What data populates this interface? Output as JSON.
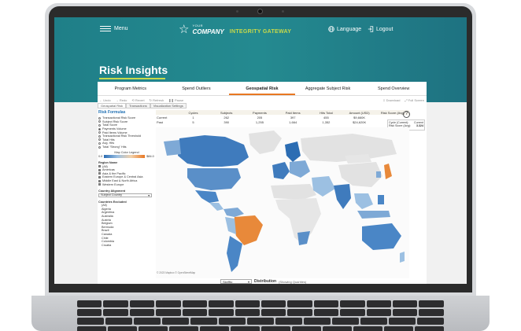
{
  "app": {
    "menu_label": "Menu",
    "logo_small": "YOUR",
    "logo_company": "COMPANY",
    "logo_gateway": "INTEGRITY GATEWAY",
    "language_label": "Language",
    "logout_label": "Logout",
    "page_title": "Risk Insights"
  },
  "tabs": [
    {
      "label": "Program Metrics"
    },
    {
      "label": "Spend Outliers"
    },
    {
      "label": "Geospatial Risk",
      "active": true
    },
    {
      "label": "Aggregate Subject Risk"
    },
    {
      "label": "Spend Overview"
    }
  ],
  "toolbar": {
    "undo": "Undo",
    "redo": "Redo",
    "revert": "Revert",
    "refresh": "Refresh",
    "pause": "Pause",
    "download": "Download",
    "full_screen": "Full Screen"
  },
  "subtabs": [
    "Geospatial Risk",
    "Transactions",
    "Visualization Settings"
  ],
  "left_panel": {
    "risk_formulas_title": "Risk Formulas",
    "options": [
      {
        "label": "Transactional Risk Score",
        "on": false
      },
      {
        "label": "Subject Risk Score",
        "on": false
      },
      {
        "label": "Total Score",
        "on": false
      },
      {
        "label": "Payments Volume",
        "on": true
      },
      {
        "label": "Paid Items Volume",
        "on": false
      },
      {
        "label": "Transactional Risk Threshold",
        "on": false
      },
      {
        "label": "Total Hits",
        "on": false
      },
      {
        "label": "Avg. Hits",
        "on": false
      },
      {
        "label": "Total \"Strong\" Hits",
        "on": false
      }
    ],
    "legend_title": "Map Color Legend",
    "legend_min": "0.0",
    "legend_max": "$84.0",
    "region_title": "Region Name",
    "regions": [
      {
        "label": "(All)",
        "on": true
      },
      {
        "label": "Americas",
        "on": true
      },
      {
        "label": "Asia & the Pacific",
        "on": true
      },
      {
        "label": "Eastern Europe & Central Asia",
        "on": true
      },
      {
        "label": "Middle East & North Africa",
        "on": true
      },
      {
        "label": "Western Europe",
        "on": true
      }
    ],
    "country_alignment_title": "Country Alignment",
    "country_alignment_value": "Subject Country",
    "countries_excluded_title": "Countries Excluded",
    "countries": [
      "(All)",
      "Algeria",
      "Argentina",
      "Australia",
      "Austria",
      "Belgium",
      "Bermuda",
      "Brazil",
      "Canada",
      "Chile",
      "Colombia",
      "Croatia"
    ]
  },
  "summary_table": {
    "headers": [
      "",
      "Cycles",
      "Subjects",
      "Payments",
      "Paid Items",
      "Hits Total",
      "Amount (USD)",
      "Risk Score (Avg)"
    ],
    "rows": [
      [
        "Current",
        "1",
        "262",
        "205",
        "397",
        "455",
        "$9,660K",
        ""
      ],
      [
        "Past",
        "5",
        "390",
        "1,255",
        "1,664",
        "1,352",
        "$24,620K",
        ""
      ]
    ]
  },
  "tooltip": {
    "label1": "Cycle (Current):",
    "value1": "Current",
    "label2": "Risk Score (Avg):",
    "value2": "3.324"
  },
  "help_icon_text": "?",
  "map_credit": "© 2023 Mapbox © OpenStreetMap",
  "distribution": {
    "dropdown_value": "Skeffto",
    "label": "Distribution",
    "sublabel": "(Showing Quartiles)"
  },
  "colors": {
    "teal": "#248a90",
    "accent_green": "#c8d94a",
    "orange": "#e87722",
    "blue_dark": "#2c6db3",
    "blue_light": "#9cc0e2"
  }
}
